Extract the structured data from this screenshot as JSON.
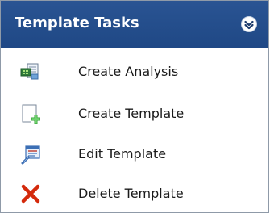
{
  "panel": {
    "title": "Template Tasks",
    "collapse_icon": "double-chevron-up-icon",
    "header_color": "#2a5493"
  },
  "tasks": [
    {
      "label": "Create Analysis",
      "icon": "create-analysis-icon"
    },
    {
      "label": "Create Template",
      "icon": "create-template-icon"
    },
    {
      "label": "Edit Template",
      "icon": "edit-template-icon"
    },
    {
      "label": "Delete Template",
      "icon": "delete-x-icon"
    }
  ]
}
